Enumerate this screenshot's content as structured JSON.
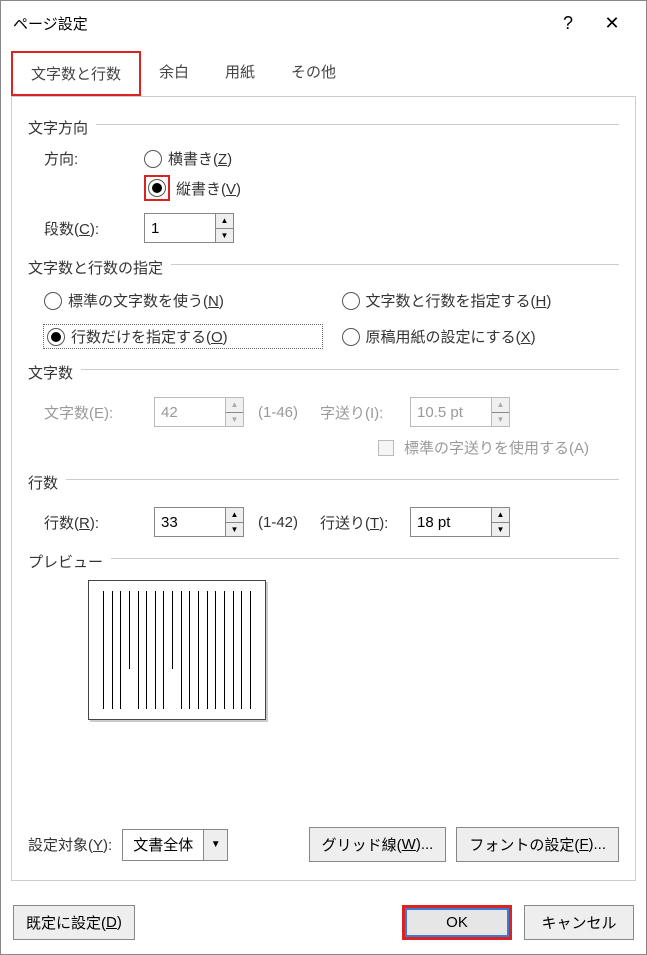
{
  "dialog": {
    "title": "ページ設定",
    "help": "?",
    "close": "✕"
  },
  "tabs": {
    "active": "文字数と行数",
    "items": [
      "文字数と行数",
      "余白",
      "用紙",
      "その他"
    ]
  },
  "text_direction": {
    "group_label": "文字方向",
    "direction_label": "方向:",
    "horizontal": "横書き(",
    "horizontal_key": "Z",
    "horizontal_tail": ")",
    "vertical": "縦書き(",
    "vertical_key": "V",
    "vertical_tail": ")",
    "columns_label": "段数(",
    "columns_key": "C",
    "columns_tail": "):",
    "columns_value": "1"
  },
  "count_spec": {
    "group_label": "文字数と行数の指定",
    "opt_standard": "標準の文字数を使う(",
    "opt_standard_key": "N",
    "opt_standard_tail": ")",
    "opt_lines_only": "行数だけを指定する(",
    "opt_lines_only_key": "O",
    "opt_lines_only_tail": ")",
    "opt_both": "文字数と行数を指定する(",
    "opt_both_key": "H",
    "opt_both_tail": ")",
    "opt_manuscript": "原稿用紙の設定にする(",
    "opt_manuscript_key": "X",
    "opt_manuscript_tail": ")"
  },
  "char_count": {
    "group_label": "文字数",
    "count_label": "文字数(E):",
    "count_value": "42",
    "count_range": "(1-46)",
    "pitch_label": "字送り(I):",
    "pitch_value": "10.5 pt",
    "std_pitch_label": "標準の字送りを使用する(A)"
  },
  "line_count": {
    "group_label": "行数",
    "count_label": "行数(",
    "count_key": "R",
    "count_tail": "):",
    "count_value": "33",
    "count_range": "(1-42)",
    "pitch_label": "行送り(",
    "pitch_key": "T",
    "pitch_tail": "):",
    "pitch_value": "18 pt"
  },
  "preview": {
    "group_label": "プレビュー"
  },
  "apply_to": {
    "label": "設定対象(",
    "key": "Y",
    "tail": "):",
    "value": "文書全体",
    "gridlines": "グリッド線(",
    "gridlines_key": "W",
    "gridlines_tail": ")...",
    "font": "フォントの設定(",
    "font_key": "F",
    "font_tail": ")..."
  },
  "footer": {
    "set_default": "既定に設定(",
    "set_default_key": "D",
    "set_default_tail": ")",
    "ok": "OK",
    "cancel": "キャンセル"
  }
}
